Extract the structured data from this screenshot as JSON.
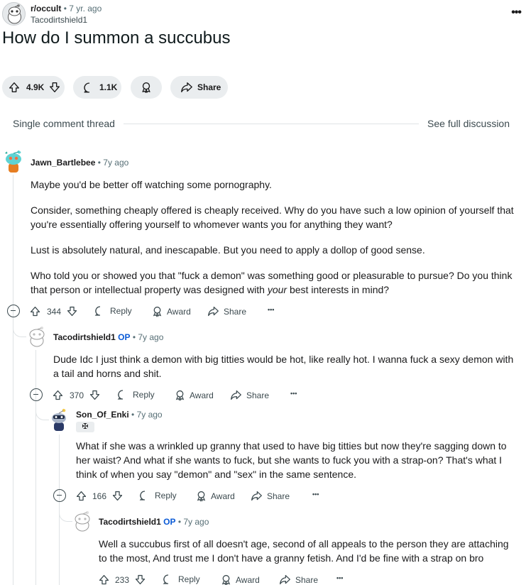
{
  "post": {
    "subreddit": "r/occult",
    "separator": "•",
    "age": "7 yr. ago",
    "author": "Tacodirtshield1",
    "more_icon": "ellipsis-horizontal-icon",
    "title": "How do I summon a succubus",
    "score": "4.9K",
    "comments": "1.1K",
    "share_label": "Share"
  },
  "thread": {
    "left_label": "Single comment thread",
    "right_label": "See full discussion"
  },
  "labels": {
    "reply": "Reply",
    "award": "Award",
    "share": "Share",
    "more": "•••",
    "op": "OP",
    "dot": "•"
  },
  "comments": [
    {
      "author": "Jawn_Bartlebee",
      "age": "7y ago",
      "paragraphs": [
        "Maybe you'd be better off watching some pornography.",
        "Consider, something cheaply offered is cheaply received. Why do you have such a low opinion of yourself that you're essentially offering yourself to whomever wants you for anything they want?",
        "Lust is absolutely natural, and inescapable. But you need to apply a dollop of good sense."
      ],
      "last_paragraph": {
        "before": "Who told you or showed you that \"fuck a demon\" was something good or pleasurable to pursue? Do you think that person or intellectual property was designed with ",
        "emphasis": "your",
        "after": " best interests in mind?"
      },
      "score": "344"
    },
    {
      "author": "Tacodirtshield1",
      "age": "7y ago",
      "paragraphs": [
        "Dude Idc I just think a demon with big titties would be hot, like really hot. I wanna fuck a sexy demon with a tail and horns and shit."
      ],
      "score": "370"
    },
    {
      "author": "Son_Of_Enki",
      "age": "7y ago",
      "flair": "✠",
      "paragraphs": [
        "What if she was a wrinkled up granny that used to have big titties but now they're sagging down to her waist? And what if she wants to fuck, but she wants to fuck you with a strap-on? That's what I think of when you say \"demon\" and \"sex\" in the same sentence."
      ],
      "score": "166"
    },
    {
      "author": "Tacodirtshield1",
      "age": "7y ago",
      "paragraphs": [
        "Well a succubus first of all doesn't age, second of all appeals to the person they are attaching to the most, And trust me I don't have a granny fetish. And I'd be fine with a strap on bro"
      ],
      "score": "233"
    }
  ]
}
